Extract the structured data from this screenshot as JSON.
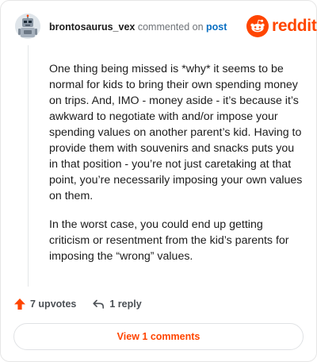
{
  "header": {
    "username": "brontosaurus_vex",
    "action_text": "commented on",
    "post_link": "post",
    "logo_text": "reddit",
    "avatar_icon": "robot-avatar-icon",
    "logo_icon": "reddit-alien-icon"
  },
  "comment": {
    "paragraphs": [
      "One thing being missed is *why* it seems to be normal for kids to bring their own spending money on trips. And, IMO - money aside - it’s because it’s awkward to negotiate with and/or impose your spending values on another parent’s kid. Having to provide them with souvenirs and snacks puts you in that position - you’re not just caretaking at that point, you’re necessarily imposing your own values on them.",
      "In the worst case, you could end up getting criticism or resentment from the kid’s parents for imposing the “wrong” values."
    ]
  },
  "footer": {
    "upvotes_label": "7 upvotes",
    "reply_label": "1 reply",
    "view_comments_label": "View 1 comments",
    "upvote_icon": "upvote-arrow-icon",
    "reply_icon": "reply-arrow-icon"
  },
  "colors": {
    "brand": "#ff4500",
    "link": "#0a6fc2",
    "text": "#1c1c1c",
    "muted": "#6f7378"
  }
}
